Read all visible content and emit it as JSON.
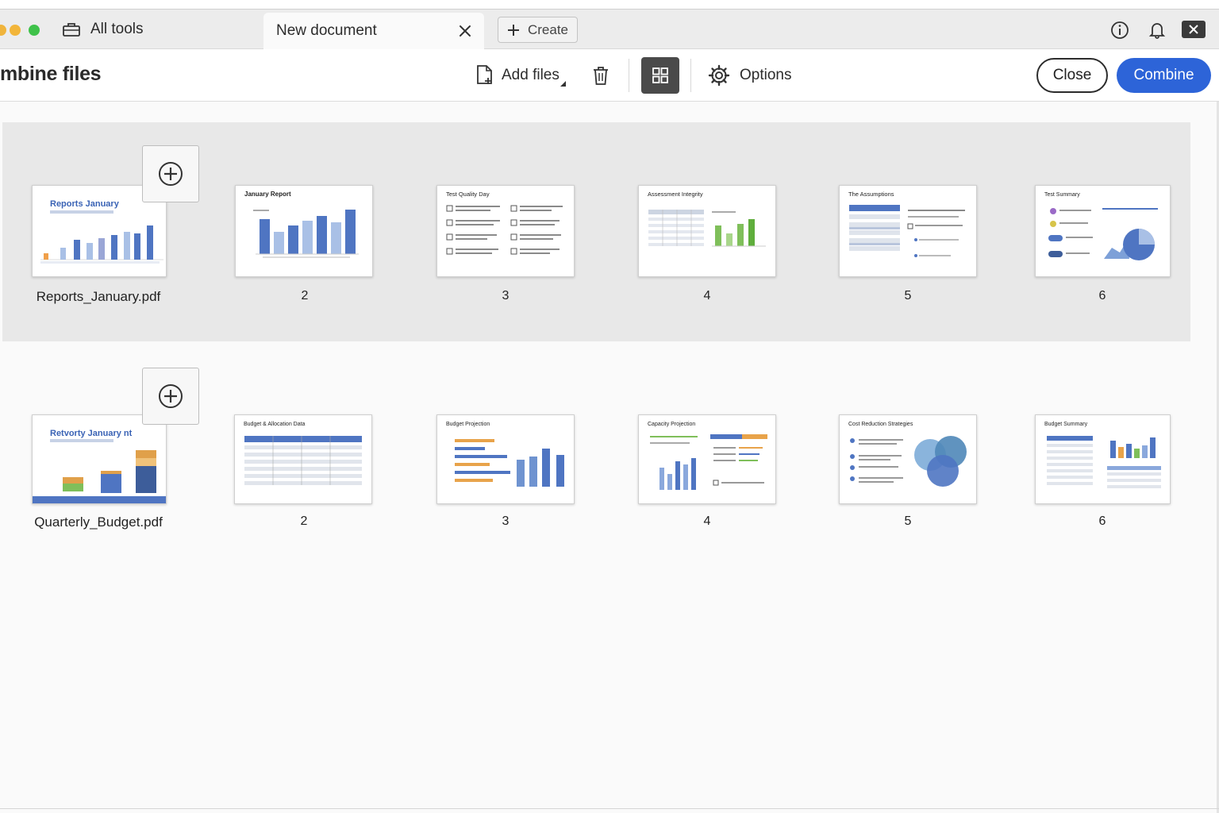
{
  "window": {
    "tools_label": "All tools",
    "tab_title": "New document",
    "create_label": "Create"
  },
  "toolbar": {
    "title": "mbine files",
    "add_files_label": "Add files",
    "options_label": "Options",
    "close_label": "Close",
    "combine_label": "Combine"
  },
  "colors": {
    "accent": "#2d64d8",
    "selected_group": "#e8e8e8"
  },
  "files": [
    {
      "name": "Reports_January.pdf",
      "first_page_title": "Reports January",
      "pages": [
        "2",
        "3",
        "4",
        "5",
        "6"
      ],
      "page_titles": [
        "January Report",
        "Test Quality Day",
        "Assessment Integrity",
        "The Assumptions",
        "Test Summary"
      ]
    },
    {
      "name": "Quarterly_Budget.pdf",
      "first_page_title": "Retvorty January nt",
      "pages": [
        "2",
        "3",
        "4",
        "5",
        "6"
      ],
      "page_titles": [
        "Budget & Allocation Data",
        "Budget Projection",
        "Capacity Projection",
        "Cost Reduction Strategies",
        "Budget Summary"
      ]
    }
  ]
}
